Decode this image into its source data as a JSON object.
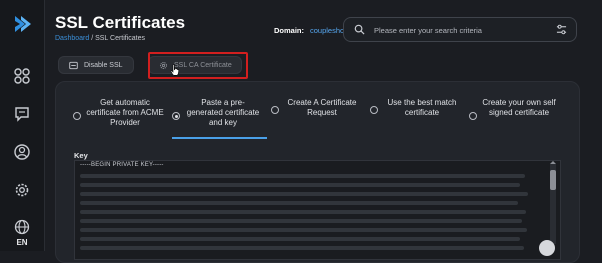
{
  "sidebar": {
    "logo": "chevron-logo",
    "items": [
      {
        "icon": "apps-icon"
      },
      {
        "icon": "chat-icon"
      },
      {
        "icon": "user-icon"
      },
      {
        "icon": "gear-icon"
      },
      {
        "icon": "globe-icon"
      }
    ],
    "language": "EN"
  },
  "header": {
    "title": "SSL Certificates",
    "breadcrumb": {
      "root": "Dashboard",
      "separator": " / ",
      "current": "SSL Certificates"
    },
    "domain_label": "Domain:",
    "domain_value": "coupleshop.ir",
    "search_placeholder": "Please enter your search criteria"
  },
  "toolbar": {
    "disable_label": "Disable SSL",
    "ca_label": "SSL CA Certificate"
  },
  "options": [
    {
      "label": "Get automatic certificate from ACME Provider",
      "selected": false
    },
    {
      "label": "Paste a pre-generated certificate and key",
      "selected": true
    },
    {
      "label": "Create A Certificate Request",
      "selected": false
    },
    {
      "label": "Use the best match certificate",
      "selected": false
    },
    {
      "label": "Create your own self signed certificate",
      "selected": false
    }
  ],
  "key_section": {
    "label": "Key",
    "content_header": "-----BEGIN PRIVATE KEY-----"
  },
  "colors": {
    "accent": "#4aa0e8",
    "highlight": "#d21f1f",
    "background": "#1b1d22"
  }
}
